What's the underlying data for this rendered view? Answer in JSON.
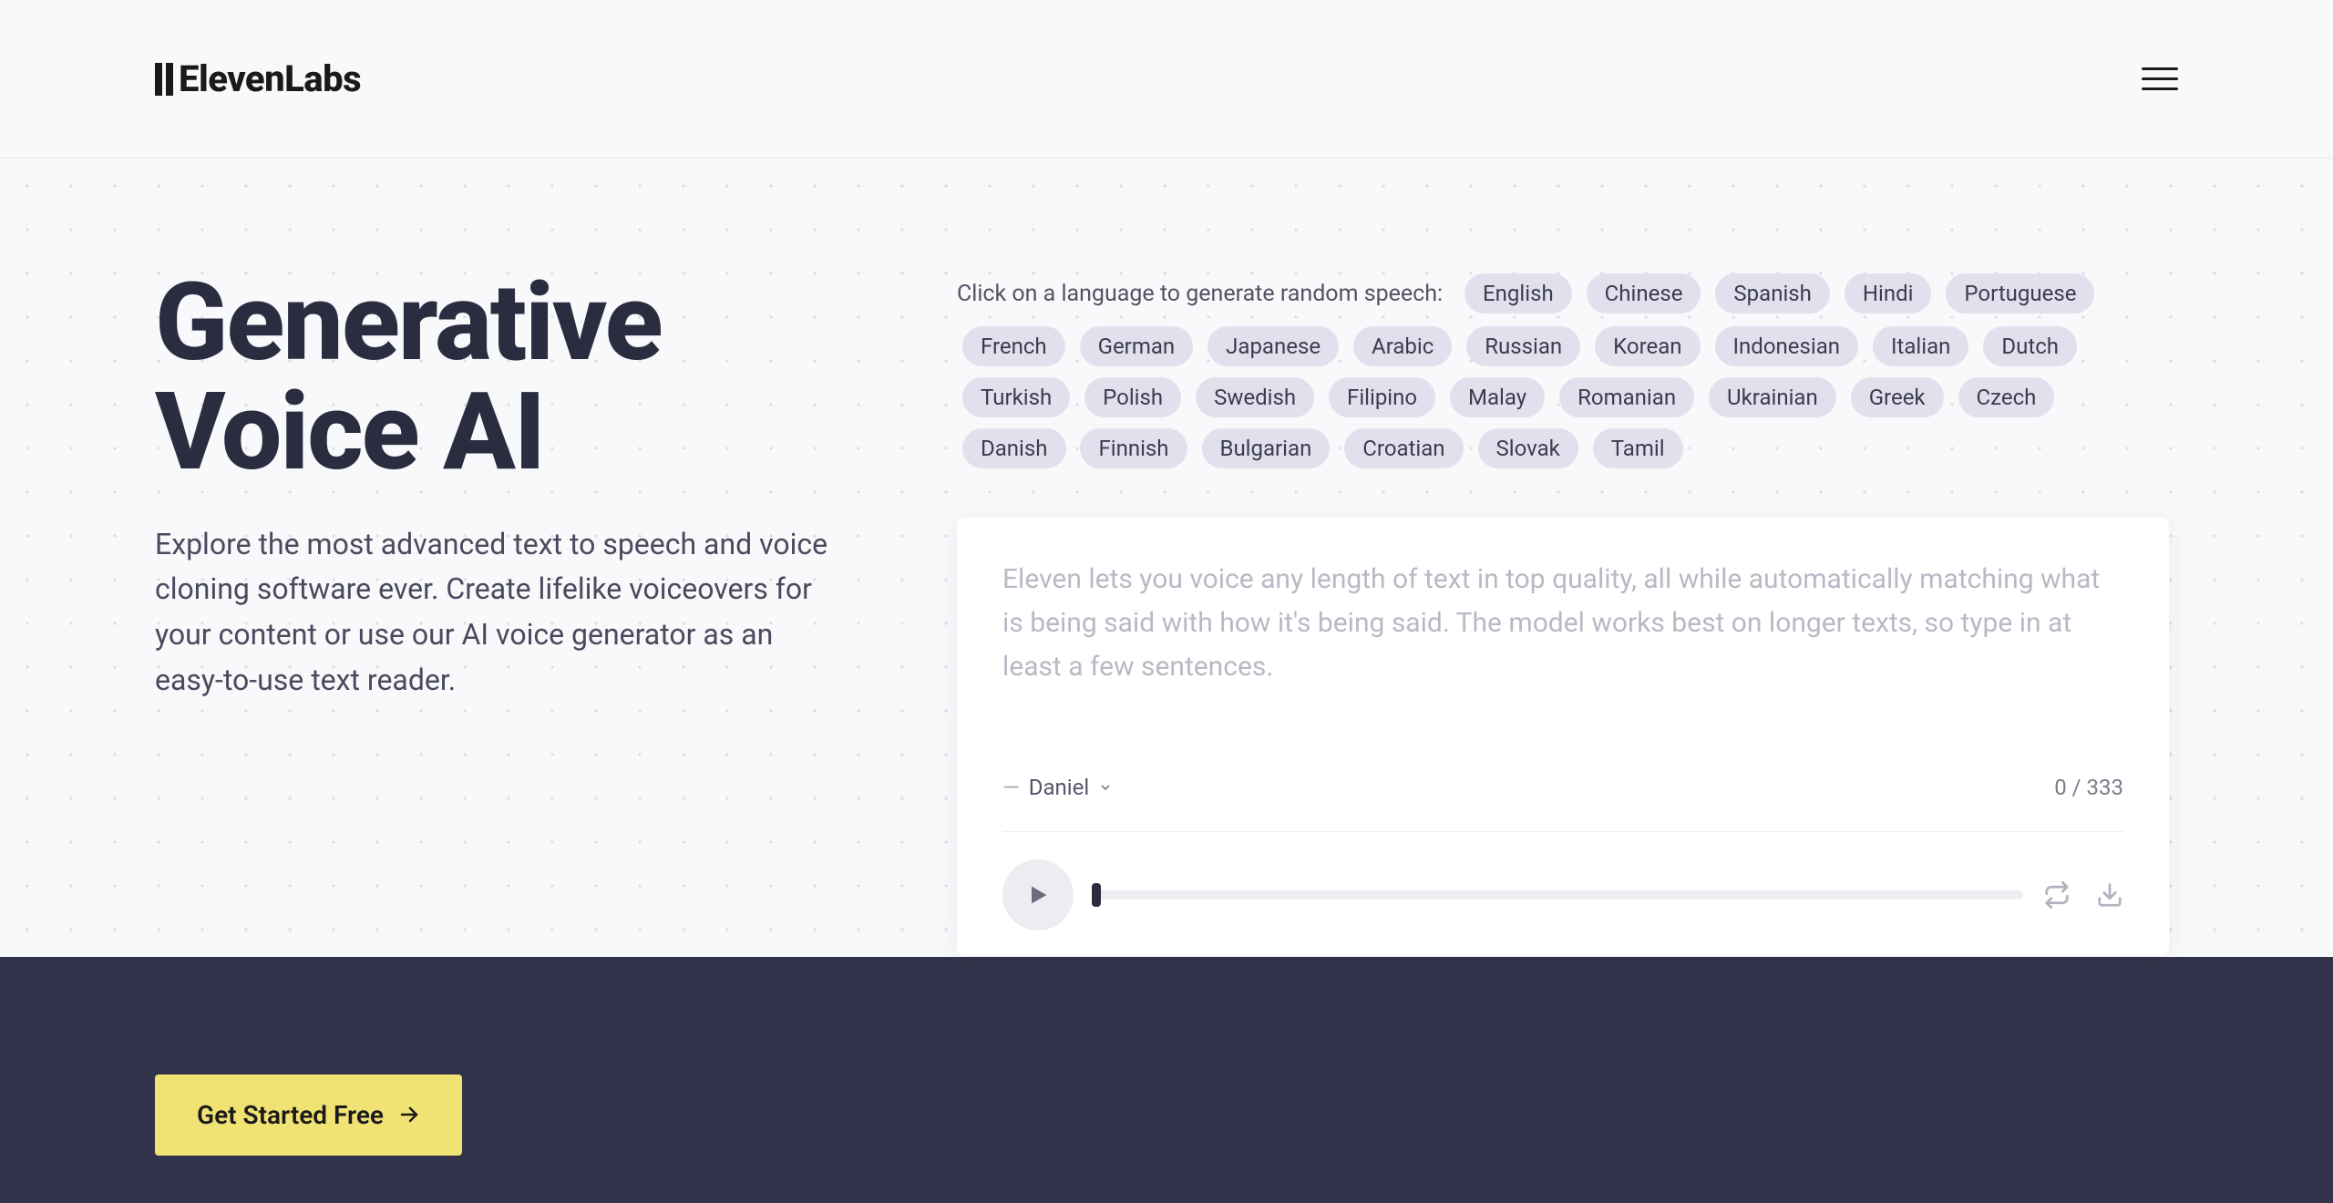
{
  "brand": "ElevenLabs",
  "hero": {
    "title": "Generative Voice AI",
    "subtitle": "Explore the most advanced text to speech and voice cloning software ever. Create lifelike voiceovers for your content or use our AI voice generator as an easy-to-use text reader."
  },
  "languages": {
    "intro": "Click on a language to generate random speech:",
    "list": [
      "English",
      "Chinese",
      "Spanish",
      "Hindi",
      "Portuguese",
      "French",
      "German",
      "Japanese",
      "Arabic",
      "Russian",
      "Korean",
      "Indonesian",
      "Italian",
      "Dutch",
      "Turkish",
      "Polish",
      "Swedish",
      "Filipino",
      "Malay",
      "Romanian",
      "Ukrainian",
      "Greek",
      "Czech",
      "Danish",
      "Finnish",
      "Bulgarian",
      "Croatian",
      "Slovak",
      "Tamil"
    ]
  },
  "editor": {
    "placeholder": "Eleven lets you voice any length of text in top quality, all while automatically matching what is being said with how it's being said. The model works best on longer texts, so type in at least a few sentences.",
    "voice_prefix": "—",
    "voice_name": "Daniel",
    "char_count": "0 / 333"
  },
  "cta": {
    "label": "Get Started Free"
  }
}
